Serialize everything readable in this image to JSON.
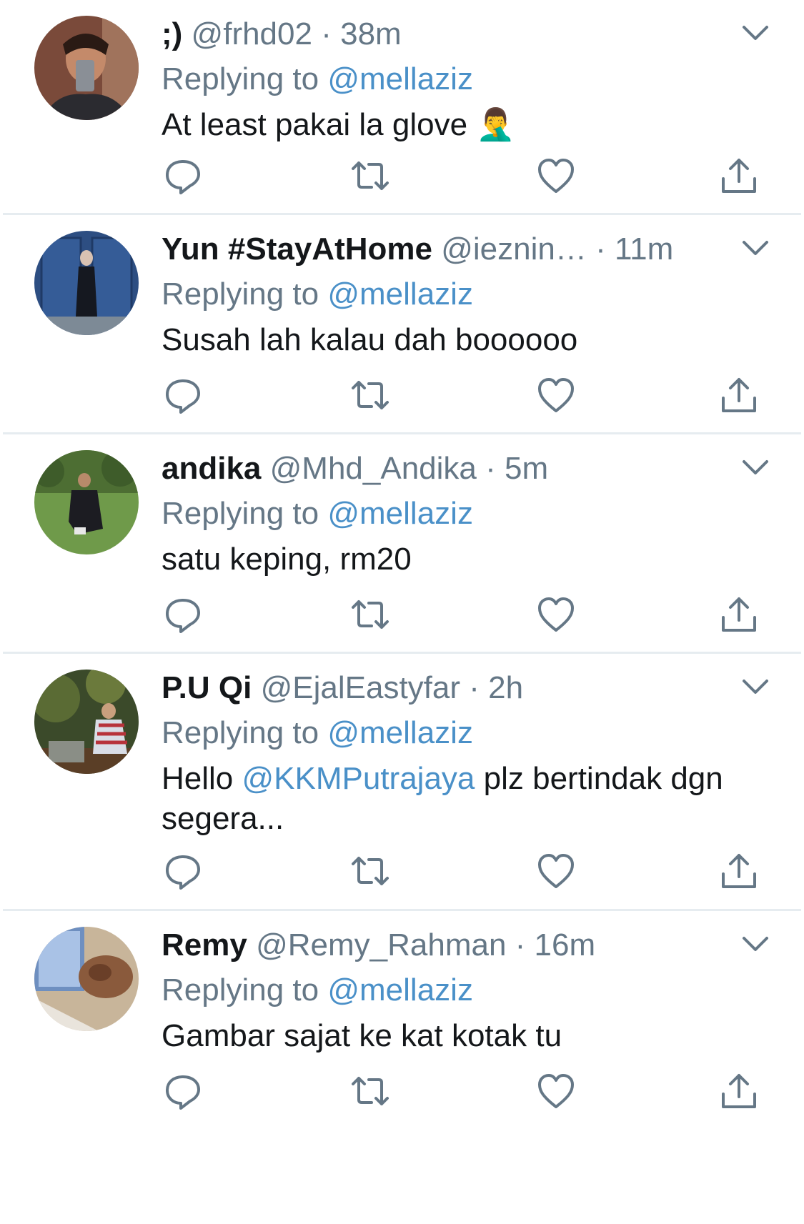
{
  "tweets": [
    {
      "name": ";)",
      "handle": "@frhd02",
      "sep": " · ",
      "time": "38m",
      "replying_prefix": "Replying to ",
      "replying_to": "@mellaziz",
      "text_before": "At least pakai la glove ",
      "text_mention": "",
      "text_after": "",
      "emoji": "🤦‍♂️"
    },
    {
      "name": "Yun #StayAtHome",
      "handle": "@ieznin…",
      "sep": "  · ",
      "time": "11m",
      "replying_prefix": "Replying to ",
      "replying_to": "@mellaziz",
      "text_before": "Susah lah kalau dah boooooo",
      "text_mention": "",
      "text_after": "",
      "emoji": ""
    },
    {
      "name": "andika",
      "handle": "@Mhd_Andika",
      "sep": " · ",
      "time": "5m",
      "replying_prefix": "Replying to ",
      "replying_to": "@mellaziz",
      "text_before": "satu keping, rm20",
      "text_mention": "",
      "text_after": "",
      "emoji": ""
    },
    {
      "name": "P.U Qi",
      "handle": "@EjalEastyfar",
      "sep": " · ",
      "time": "2h",
      "replying_prefix": "Replying to ",
      "replying_to": "@mellaziz",
      "text_before": "Hello ",
      "text_mention": "@KKMPutrajaya",
      "text_after": " plz bertindak dgn segera...",
      "emoji": ""
    },
    {
      "name": "Remy",
      "handle": "@Remy_Rahman",
      "sep": " · ",
      "time": "16m",
      "replying_prefix": "Replying to ",
      "replying_to": "@mellaziz",
      "text_before": "Gambar sajat ke kat kotak tu",
      "text_mention": "",
      "text_after": "",
      "emoji": ""
    }
  ],
  "icons": {
    "reply": "reply-icon",
    "retweet": "retweet-icon",
    "like": "like-icon",
    "share": "share-icon",
    "more": "chevron-down-icon"
  },
  "colors": {
    "link": "#4a90c8",
    "secondary_text": "#657786",
    "primary_text": "#14171a",
    "divider": "#e6ecf0"
  }
}
